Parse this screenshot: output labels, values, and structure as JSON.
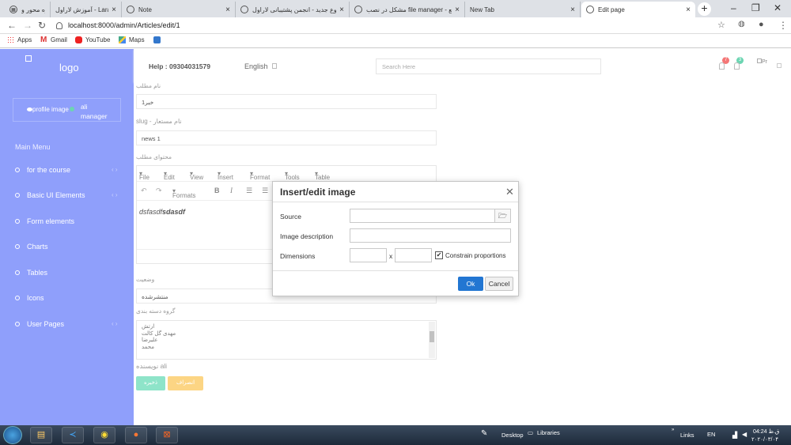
{
  "browser": {
    "tabs": [
      {
        "title": "پروژه محور و",
        "icon": "laravel-icon",
        "active": false
      },
      {
        "title": "آموزش لاراول - Laravel",
        "icon": "laravel-icon",
        "active": false
      },
      {
        "title": "Note",
        "icon": "globe-icon",
        "active": false
      },
      {
        "title": "ایجاد موضوع جدید - انجمن پشتیبانی لاراول",
        "icon": "globe-icon",
        "active": false
      },
      {
        "title": "مشکل در نصب file manager - رفع",
        "icon": "globe-icon",
        "active": false
      },
      {
        "title": "New Tab",
        "icon": "",
        "active": false
      },
      {
        "title": "Edit page",
        "icon": "globe-icon",
        "active": true
      }
    ],
    "url": "localhost:8000/admin/Articles/edit/1",
    "bookmarks": [
      {
        "label": "Apps",
        "icon": "apps-grid-icon"
      },
      {
        "label": "Gmail",
        "icon": "gmail-icon"
      },
      {
        "label": "YouTube",
        "icon": "youtube-icon"
      },
      {
        "label": "Maps",
        "icon": "maps-icon"
      }
    ]
  },
  "sidebar": {
    "logo_text": "logo",
    "profile_image_alt": "profile image",
    "profile_name": "ali",
    "profile_role": "manager",
    "menu_title": "Main Menu",
    "items": [
      {
        "label": "for the course"
      },
      {
        "label": "Basic UI Elements"
      },
      {
        "label": "Form elements"
      },
      {
        "label": "Charts"
      },
      {
        "label": "Tables"
      },
      {
        "label": "Icons"
      },
      {
        "label": "User Pages"
      }
    ]
  },
  "header": {
    "help": "Help : 09304031579",
    "language": "English",
    "search_placeholder": "Search Here",
    "badge_1": "7",
    "badge_2": "3",
    "avatar_alt": "Pr"
  },
  "form": {
    "title_label": "نام مطلب",
    "title_value": "خبر1",
    "slug_label": "slug - نام مستعار",
    "slug_value": "news 1",
    "content_label": "محتوای مطلب",
    "editor_menu": [
      "File",
      "Edit",
      "View",
      "Insert",
      "Format",
      "Tools",
      "Table"
    ],
    "editor_formats": "Formats",
    "editor_text_a": "dsfasdf",
    "editor_text_b": "sdasdf",
    "status_label": "وضعیت",
    "status_value": "منتشرشده",
    "category_label": "گروه دسته بندی",
    "categories": [
      "ارتش",
      "مهدی گل کالت",
      "علیرضا",
      "محمد"
    ],
    "author_label": "نویسنده",
    "author_value": "ali",
    "save_button": "ذخیره",
    "cancel_button": "انصراف"
  },
  "modal": {
    "title": "Insert/edit image",
    "source_label": "Source",
    "description_label": "Image description",
    "dimensions_label": "Dimensions",
    "dimension_separator": "x",
    "constrain_label": "Constrain proportions",
    "constrain_checked": true,
    "ok_button": "Ok",
    "cancel_button": "Cancel"
  },
  "taskbar": {
    "desktop_label": "Desktop",
    "libraries_label": "Libraries",
    "links_label": "Links",
    "lang": "EN",
    "time": "04:24",
    "ampm": "ق.ظ",
    "date": "۲۰۲۰/۰۳/۰۴"
  },
  "colors": {
    "sidebar_bg": "#8f9ffb",
    "ok_button": "#2276d2",
    "save_button": "#8ee4c9",
    "cancel_button": "#fcd584",
    "badge_red": "#f47676",
    "badge_green": "#6cd5b2"
  }
}
